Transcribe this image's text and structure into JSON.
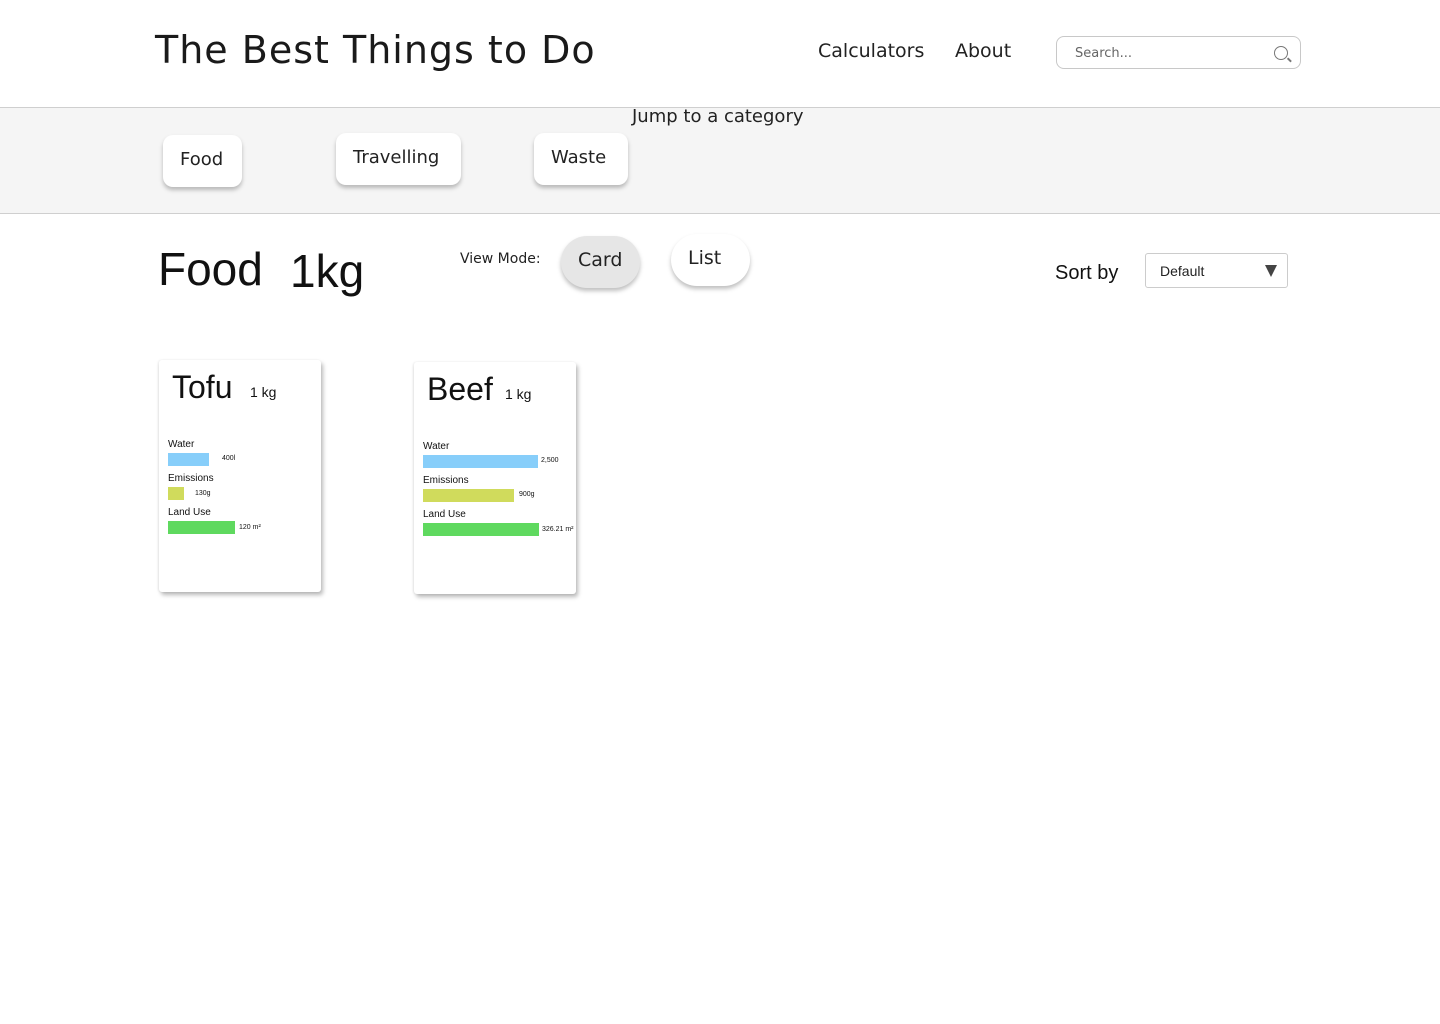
{
  "header": {
    "title": "The Best Things to Do",
    "nav": [
      "Calculators",
      "About"
    ],
    "search_placeholder": "Search..."
  },
  "categories": {
    "jump_label": "Jump to a category",
    "items": [
      "Food",
      "Travelling",
      "Waste"
    ]
  },
  "section": {
    "title": "Food",
    "unit": "1kg",
    "view_mode_label": "View Mode:",
    "view_modes": [
      "Card",
      "List"
    ],
    "active_view_mode": "Card",
    "sort_label": "Sort by",
    "sort_value": "Default"
  },
  "metric_colors": {
    "water": "#87cefa",
    "emissions": "#d0db5c",
    "land_use": "#5fd95f"
  },
  "cards": [
    {
      "name": "Tofu",
      "quantity": "1 kg",
      "metrics": [
        {
          "label": "Water",
          "value": "400l",
          "level": 0.35
        },
        {
          "label": "Emissions",
          "value": "130g",
          "level": 0.14
        },
        {
          "label": "Land Use",
          "value": "120 m²",
          "level": 0.57
        }
      ]
    },
    {
      "name": "Beef",
      "quantity": "1 kg",
      "metrics": [
        {
          "label": "Water",
          "value": "2,500",
          "level": 0.98
        },
        {
          "label": "Emissions",
          "value": "900g",
          "level": 0.78
        },
        {
          "label": "Land Use",
          "value": "326.21 m²",
          "level": 0.99
        }
      ]
    }
  ]
}
